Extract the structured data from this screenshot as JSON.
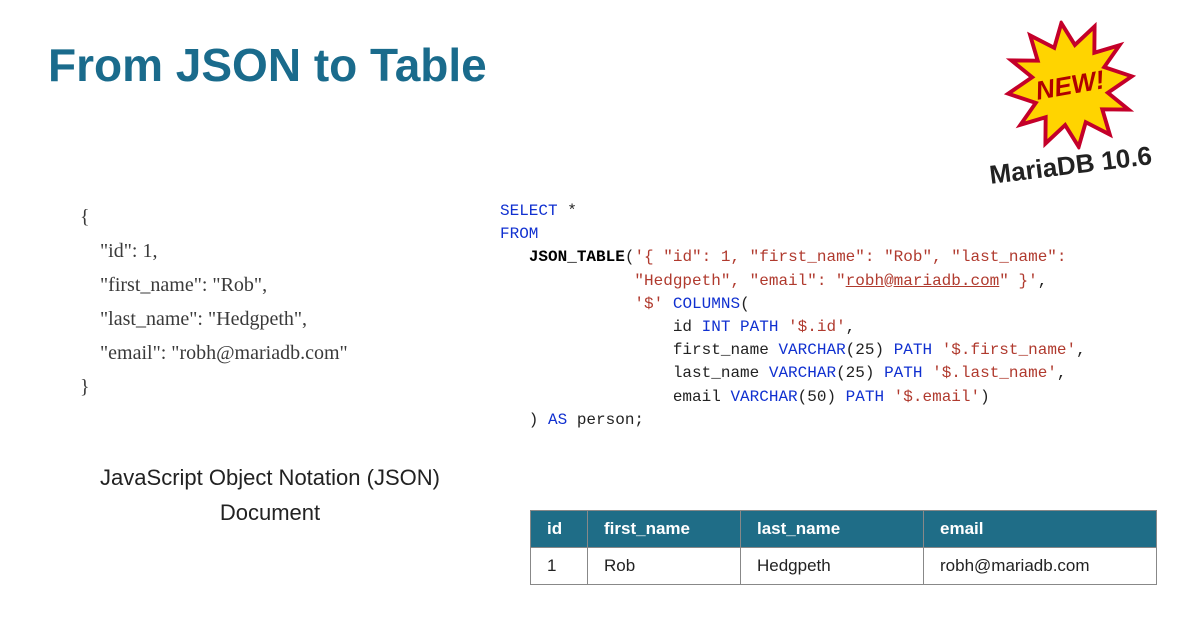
{
  "title": "From JSON to Table",
  "badge": {
    "text": "NEW!",
    "version": "MariaDB 10.6"
  },
  "json_doc": {
    "open": "{",
    "l1": "    \"id\": 1,",
    "l2": "    \"first_name\": \"Rob\",",
    "l3": "    \"last_name\": \"Hedgpeth\",",
    "l4": "    \"email\": \"robh@mariadb.com\"",
    "close": "}",
    "caption1": "JavaScript Object Notation (JSON)",
    "caption2": "Document"
  },
  "sql": {
    "select": "SELECT",
    "star": " *",
    "from": "FROM",
    "json_table": "JSON_TABLE",
    "jt_open": "(",
    "arg1a": "'{ \"id\": 1, \"first_name\": \"Rob\", \"last_name\":",
    "arg1b": "\"Hedgpeth\", \"email\": \"",
    "arg1_link": "robh@mariadb.com",
    "arg1c": "\" }'",
    "comma": ",",
    "root": "'$'",
    "columns_kw": "COLUMNS",
    "paren_open": "(",
    "col_id_a": "id ",
    "col_id_b": "INT PATH",
    "col_id_c": " '$.id'",
    "col_fn_a": "first_name ",
    "col_fn_b": "VARCHAR",
    "col_fn_c": "(25) ",
    "col_fn_d": "PATH",
    "col_fn_e": " '$.first_name'",
    "col_ln_a": "last_name ",
    "col_ln_b": "VARCHAR",
    "col_ln_c": "(25) ",
    "col_ln_d": "PATH",
    "col_ln_e": " '$.last_name'",
    "col_em_a": "email ",
    "col_em_b": "VARCHAR",
    "col_em_c": "(50) ",
    "col_em_d": "PATH",
    "col_em_e": " '$.email'",
    "paren_close": ")",
    "as_kw": "AS",
    "alias": " person;"
  },
  "table": {
    "headers": {
      "c1": "id",
      "c2": "first_name",
      "c3": "last_name",
      "c4": "email"
    },
    "row1": {
      "c1": "1",
      "c2": "Rob",
      "c3": "Hedgpeth",
      "c4": "robh@mariadb.com"
    }
  },
  "chart_data": {
    "type": "table",
    "title": "From JSON to Table",
    "columns": [
      "id",
      "first_name",
      "last_name",
      "email"
    ],
    "rows": [
      [
        1,
        "Rob",
        "Hedgpeth",
        "robh@mariadb.com"
      ]
    ]
  }
}
